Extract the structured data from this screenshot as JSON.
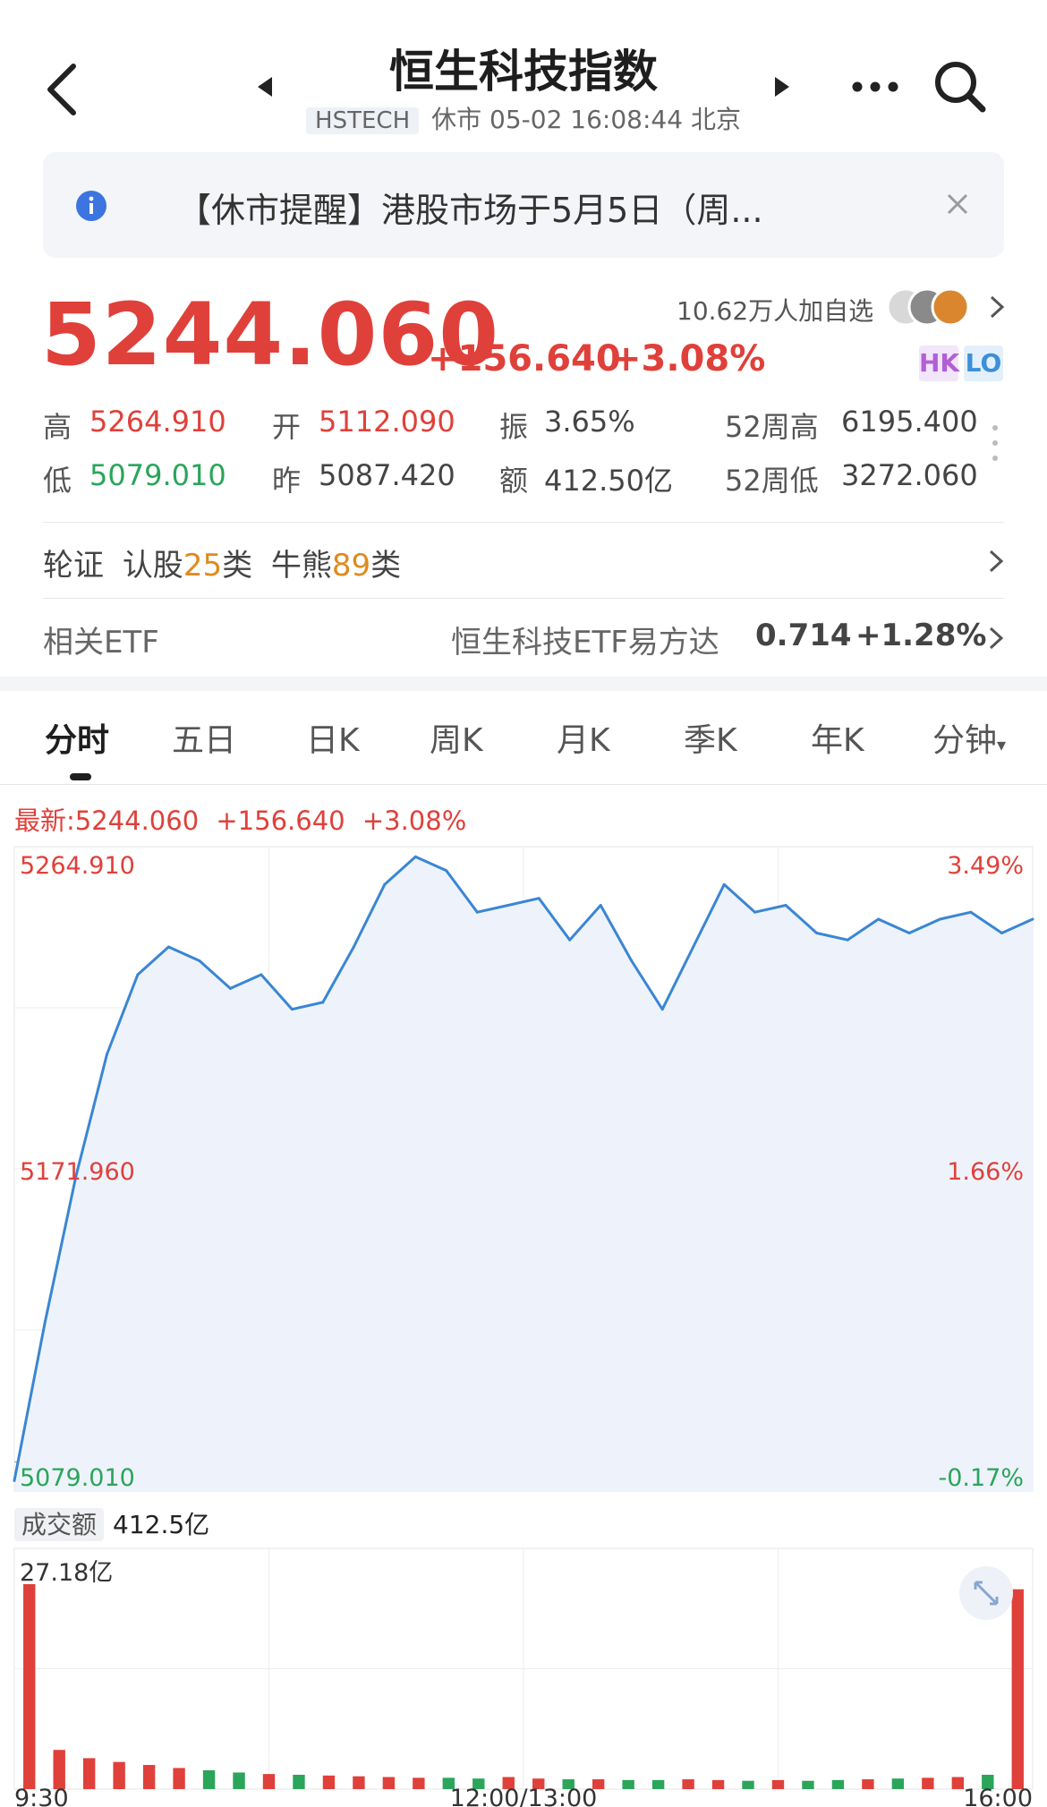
{
  "header": {
    "title": "恒生科技指数",
    "code": "HSTECH",
    "status": "休市 05-02 16:08:44 北京"
  },
  "notice": {
    "text": "【休市提醒】港股市场于5月5日（周..."
  },
  "quote": {
    "price": "5244.060",
    "change": "+156.640",
    "change_pct": "+3.08%",
    "watchers": "10.62万人加自选",
    "badge_hk": "HK",
    "badge_lo": "LO"
  },
  "stats": {
    "high_label": "高",
    "high": "5264.910",
    "open_label": "开",
    "open": "5112.090",
    "amp_label": "振",
    "amp": "3.65%",
    "w52h_label": "52周高",
    "w52h": "6195.400",
    "low_label": "低",
    "low": "5079.010",
    "prev_label": "昨",
    "prev": "5087.420",
    "amount_label": "额",
    "amount": "412.50亿",
    "w52l_label": "52周低",
    "w52l": "3272.060"
  },
  "warrants": {
    "label": "轮证",
    "call_label": "认股",
    "call_count": "25",
    "call_unit": "类",
    "bull_label": "牛熊",
    "bull_count": "89",
    "bull_unit": "类"
  },
  "etf": {
    "label": "相关ETF",
    "name": "恒生科技ETF易方达",
    "price": "0.714",
    "change": "+1.28%"
  },
  "tabs": [
    "分时",
    "五日",
    "日K",
    "周K",
    "月K",
    "季K",
    "年K",
    "分钟"
  ],
  "latest": {
    "label": "最新:5244.060",
    "change": "+156.640",
    "pct": "+3.08%"
  },
  "colors": {
    "up": "#e0403a",
    "down": "#2aa55a",
    "line": "#3a86d4",
    "area": "#eef3fb"
  },
  "chart_data": {
    "type": "area",
    "title": "",
    "y_axis_left": [
      "5264.910",
      "5171.960",
      "5079.010"
    ],
    "y_axis_right": [
      "3.49%",
      "1.66%",
      "-0.17%"
    ],
    "ylim": [
      5079.01,
      5264.91
    ],
    "x_ticks": [
      "9:30",
      "12:00/13:00",
      "16:00"
    ],
    "prev_close": 5087.42,
    "x": [
      "9:30",
      "9:40",
      "9:50",
      "10:00",
      "10:10",
      "10:20",
      "10:30",
      "10:40",
      "10:50",
      "11:00",
      "11:10",
      "11:20",
      "11:30",
      "11:40",
      "11:50",
      "12:00",
      "13:10",
      "13:20",
      "13:30",
      "13:40",
      "13:50",
      "14:00",
      "14:10",
      "14:20",
      "14:30",
      "14:40",
      "14:50",
      "15:00",
      "15:10",
      "15:20",
      "15:30",
      "15:40",
      "15:50",
      "16:00"
    ],
    "values": [
      5082,
      5128,
      5170,
      5205,
      5228,
      5236,
      5232,
      5224,
      5228,
      5218,
      5220,
      5236,
      5254,
      5262,
      5258,
      5246,
      5248,
      5250,
      5238,
      5248,
      5232,
      5218,
      5236,
      5254,
      5246,
      5248,
      5240,
      5238,
      5244,
      5240,
      5244,
      5246,
      5240,
      5244
    ],
    "volume": {
      "label": "成交额",
      "total": "412.5亿",
      "max_label": "27.18亿",
      "values": [
        27.18,
        5.2,
        4.1,
        3.6,
        3.2,
        2.8,
        2.5,
        2.2,
        2.0,
        1.9,
        1.8,
        1.7,
        1.6,
        1.5,
        1.5,
        1.4,
        1.6,
        1.4,
        1.3,
        1.3,
        1.2,
        1.2,
        1.3,
        1.2,
        1.1,
        1.2,
        1.1,
        1.2,
        1.3,
        1.4,
        1.5,
        1.6,
        1.9,
        26.5
      ]
    }
  }
}
